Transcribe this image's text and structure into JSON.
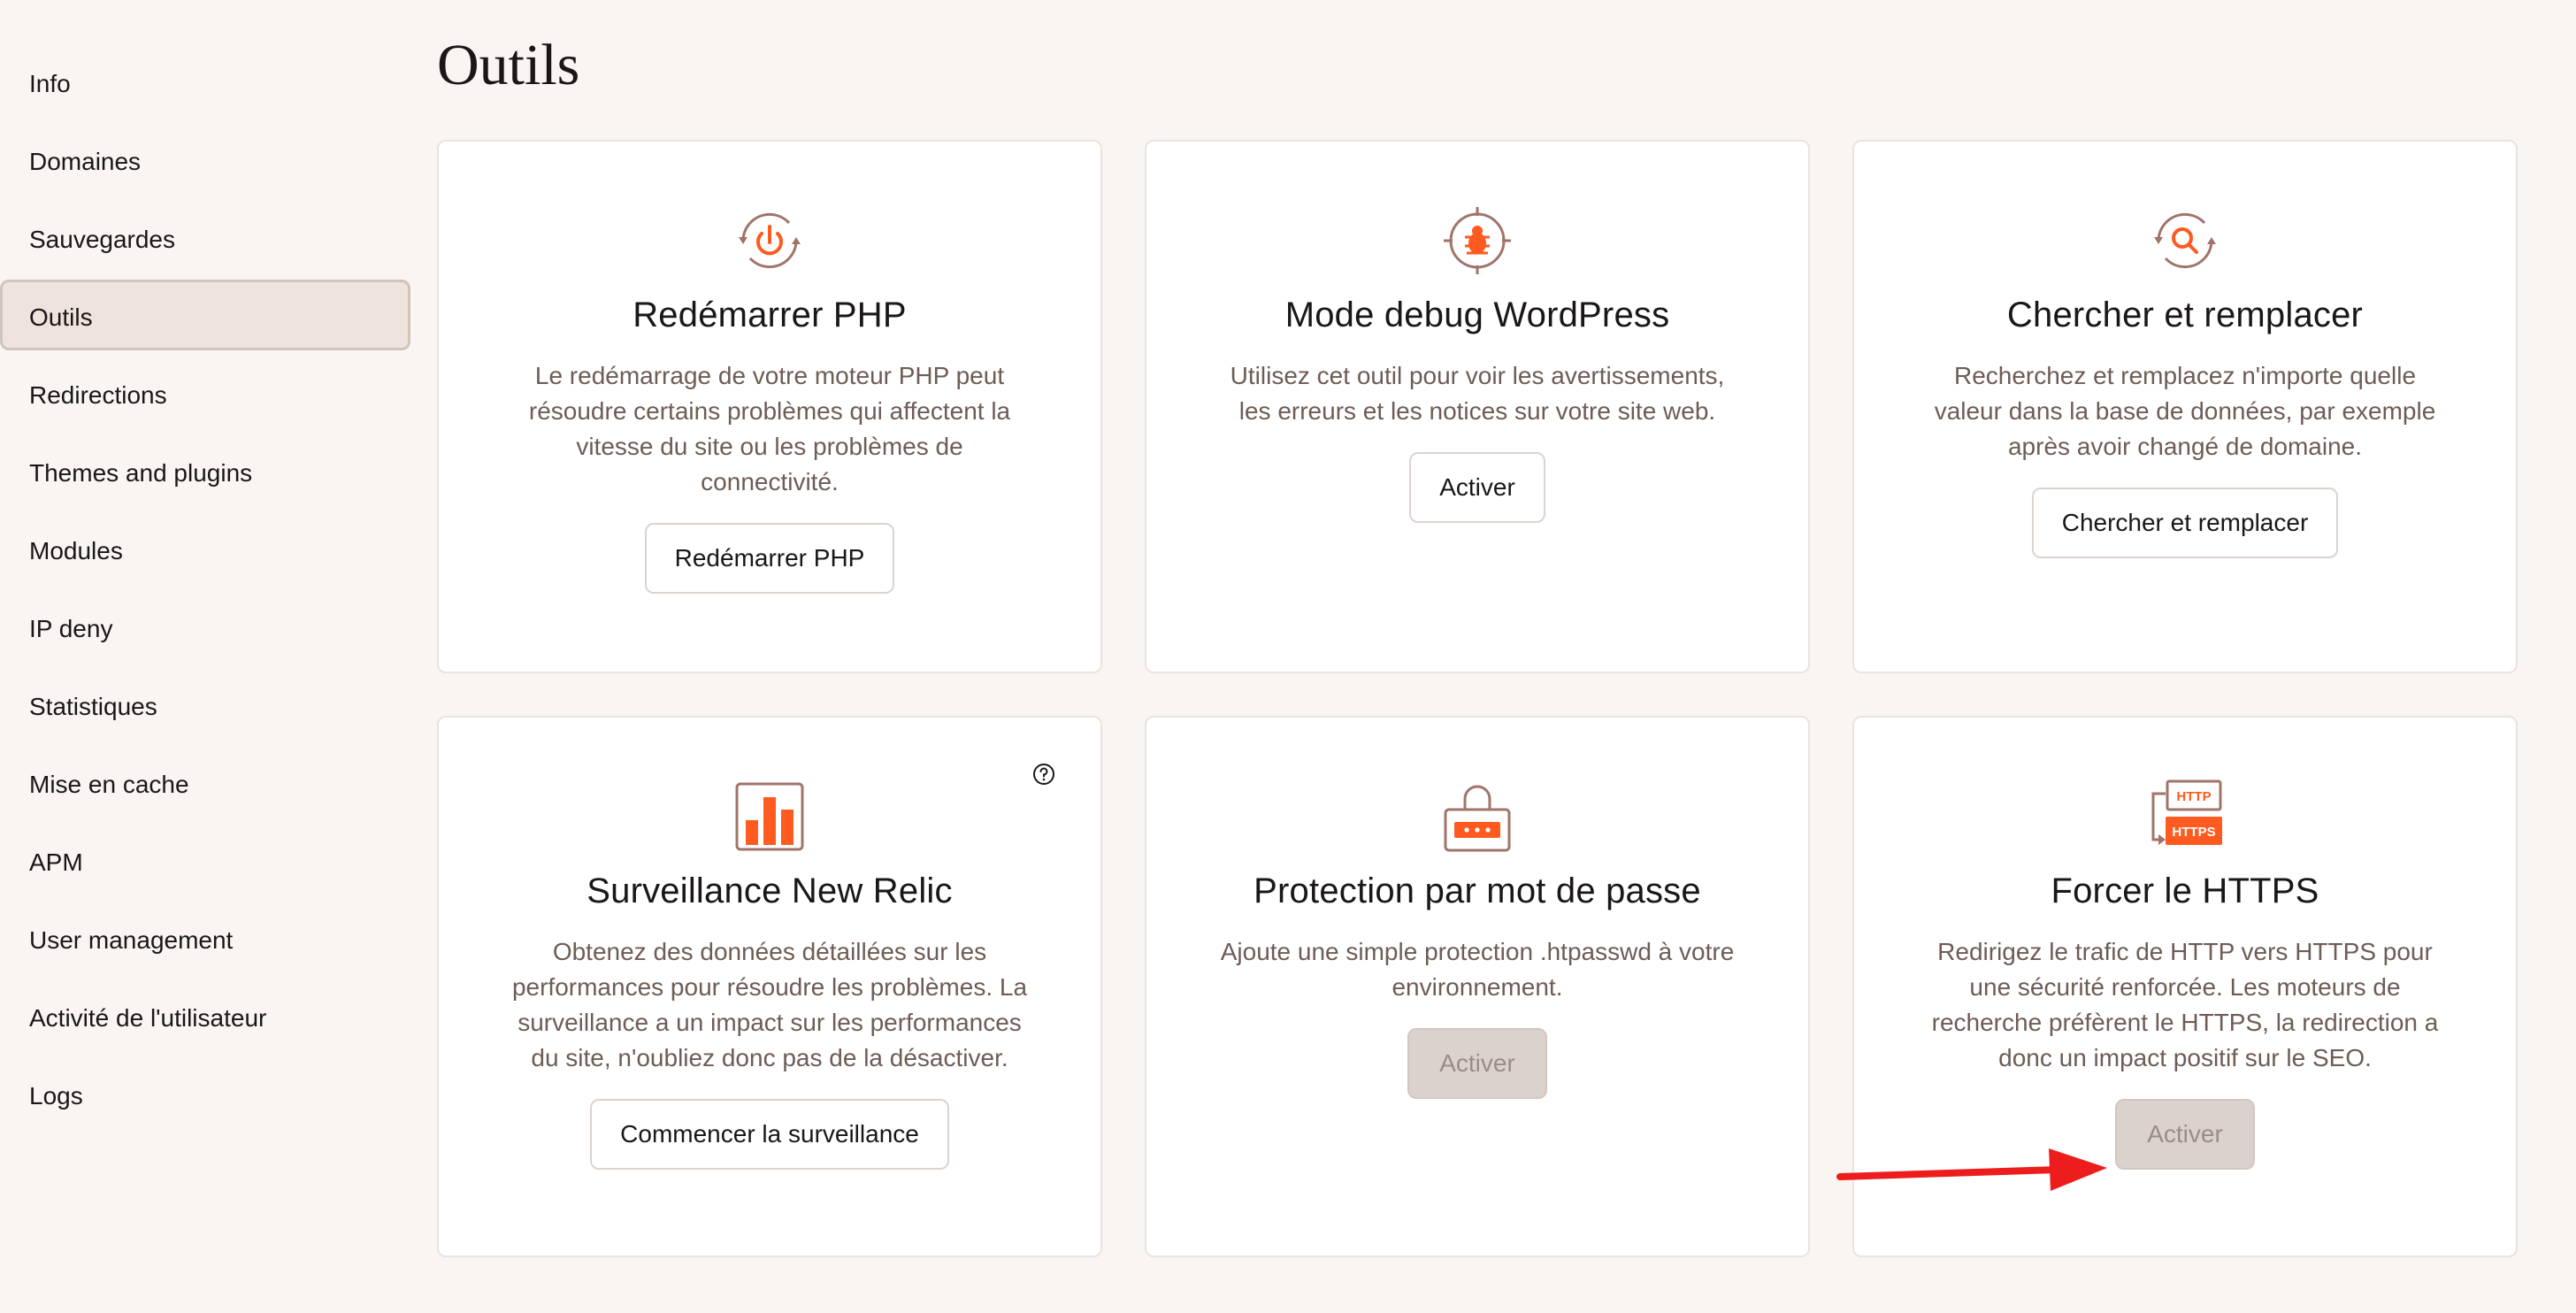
{
  "sidebar": {
    "items": [
      {
        "label": "Info"
      },
      {
        "label": "Domaines"
      },
      {
        "label": "Sauvegardes"
      },
      {
        "label": "Outils",
        "active": true
      },
      {
        "label": "Redirections"
      },
      {
        "label": "Themes and plugins"
      },
      {
        "label": "Modules"
      },
      {
        "label": "IP deny"
      },
      {
        "label": "Statistiques"
      },
      {
        "label": "Mise en cache"
      },
      {
        "label": "APM"
      },
      {
        "label": "User management"
      },
      {
        "label": "Activité de l'utilisateur"
      },
      {
        "label": "Logs"
      }
    ]
  },
  "page": {
    "title": "Outils"
  },
  "colors": {
    "accent": "#ff5a1f",
    "icon_stroke": "#a0746a",
    "button_disabled_bg": "#dcd2cd",
    "annotation": "#ee1d1d"
  },
  "cards": [
    {
      "icon": "restart-php-icon",
      "title": "Redémarrer PHP",
      "description": "Le redémarrage de votre moteur PHP peut résoudre certains problèmes qui affectent la vitesse du site ou les problèmes de connectivité.",
      "button": "Redémarrer PHP",
      "button_disabled": false
    },
    {
      "icon": "debug-bug-icon",
      "title": "Mode debug WordPress",
      "description": "Utilisez cet outil pour voir les avertissements, les erreurs et les notices sur votre site web.",
      "button": "Activer",
      "button_disabled": false
    },
    {
      "icon": "search-replace-icon",
      "title": "Chercher et remplacer",
      "description": "Recherchez et remplacez n'importe quelle valeur dans la base de données, par exemple après avoir changé de domaine.",
      "button": "Chercher et remplacer",
      "button_disabled": false
    },
    {
      "icon": "bar-chart-icon",
      "title": "Surveillance New Relic",
      "description": "Obtenez des données détaillées sur les performances pour résoudre les problèmes. La surveillance a un impact sur les performances du site, n'oubliez donc pas de la désactiver.",
      "button": "Commencer la surveillance",
      "button_disabled": false,
      "help_icon": "help-circle-icon"
    },
    {
      "icon": "password-lock-icon",
      "title": "Protection par mot de passe",
      "description": "Ajoute une simple protection .htpasswd à votre environnement.",
      "button": "Activer",
      "button_disabled": true
    },
    {
      "icon": "https-redirect-icon",
      "icon_text_top": "HTTP",
      "icon_text_bottom": "HTTPS",
      "title": "Forcer le HTTPS",
      "description": "Redirigez le trafic de HTTP vers HTTPS pour une sécurité renforcée. Les moteurs de recherche préfèrent le HTTPS, la redirection a donc un impact positif sur le SEO.",
      "button": "Activer",
      "button_disabled": true
    }
  ]
}
